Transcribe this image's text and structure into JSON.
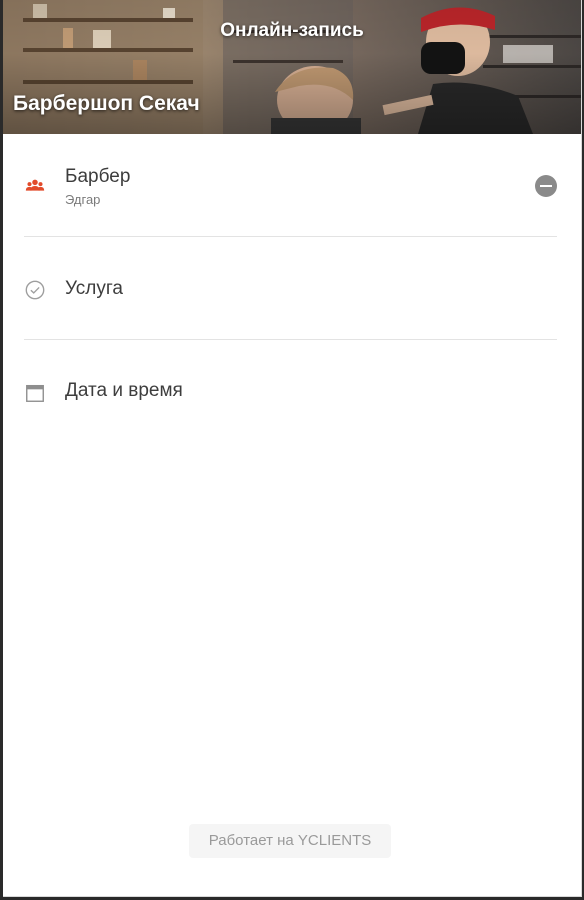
{
  "header": {
    "title": "Онлайн-запись",
    "company_name": "Барбершоп Секач"
  },
  "menu": {
    "items": [
      {
        "label": "Барбер",
        "sub": "Эдгар",
        "icon": "staff-group-icon",
        "has_remove": true
      },
      {
        "label": "Услуга",
        "icon": "check-circle-icon"
      },
      {
        "label": "Дата и время",
        "icon": "calendar-icon"
      }
    ]
  },
  "footer": {
    "powered_by": "Работает на YCLIENTS"
  },
  "colors": {
    "accent": "#e24b2b",
    "text_primary": "#3d3d3d",
    "text_secondary": "#7b7b7b",
    "divider": "#e3e3e3",
    "remove_button": "#8a8a8a"
  }
}
